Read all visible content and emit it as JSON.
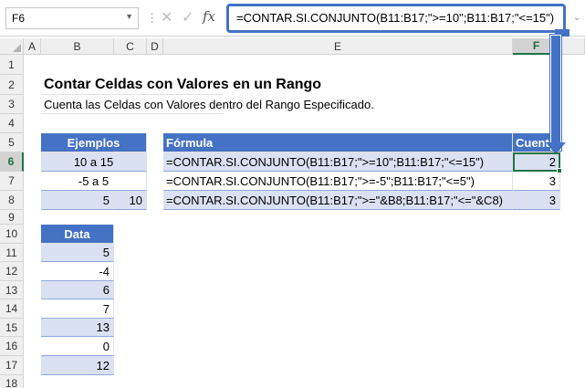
{
  "formula_bar": {
    "name_box": "F6",
    "cancel_icon": "✕",
    "enter_icon": "✓",
    "fx_label": "fx",
    "formula": "=CONTAR.SI.CONJUNTO(B11:B17;\">=10\";B11:B17;\"<=15\")"
  },
  "columns": [
    "A",
    "B",
    "C",
    "D",
    "E",
    "F"
  ],
  "rows": [
    "1",
    "2",
    "3",
    "4",
    "5",
    "6",
    "7",
    "8",
    "9",
    "10",
    "11",
    "12",
    "13",
    "14",
    "15",
    "16",
    "17",
    "18"
  ],
  "sheet": {
    "title": "Contar Celdas con Valores en un Rango",
    "subtitle": "Cuenta las Celdas con Valores dentro del Rango Especificado.",
    "ejemplos_header": "Ejemplos",
    "formula_header": "Fórmula",
    "cuenta_header": "Cuenta",
    "examples": [
      {
        "b": "10 a 15",
        "c": "",
        "formula": "=CONTAR.SI.CONJUNTO(B11:B17;\">=10\";B11:B17;\"<=15\")",
        "count": "2"
      },
      {
        "b": "-5 a 5",
        "c": "",
        "formula": "=CONTAR.SI.CONJUNTO(B11:B17;\">=-5\";B11:B17;\"<=5\")",
        "count": "3"
      },
      {
        "b": "5",
        "c": "10",
        "formula": "=CONTAR.SI.CONJUNTO(B11:B17;\">=\"&B8;B11:B17;\"<=\"&C8)",
        "count": "3"
      }
    ],
    "data_header": "Data",
    "data": [
      "5",
      "-4",
      "6",
      "7",
      "13",
      "0",
      "12"
    ]
  },
  "colors": {
    "accent": "#4472c4",
    "light": "#d9e1f2",
    "selection": "#217346"
  }
}
